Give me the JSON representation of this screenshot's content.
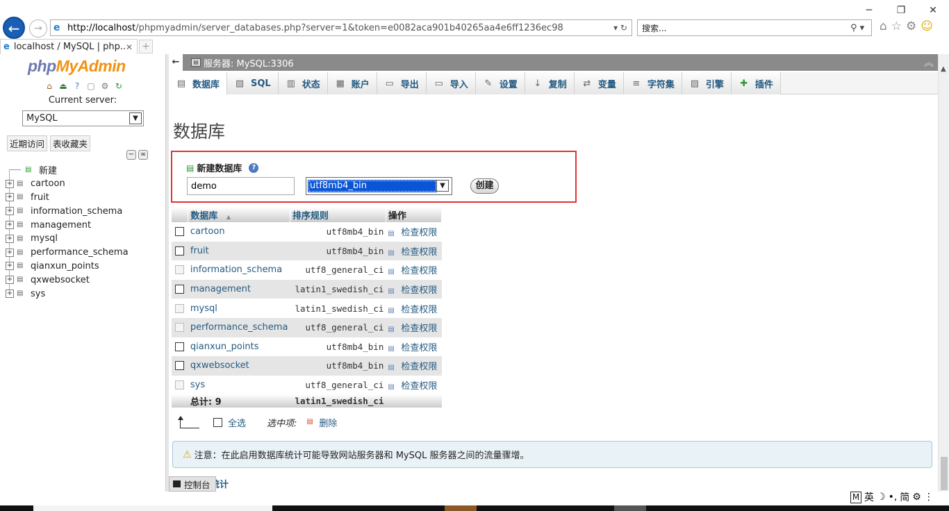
{
  "browser": {
    "url_host": "http://localhost",
    "url_rest": "/phpmyadmin/server_databases.php?server=1&token=e0082aca901b40265aa4e6ff1236ec98",
    "search_placeholder": "搜索...",
    "tab_title": "localhost / MySQL | php...",
    "tab_close": "✕",
    "new_tab": "＋"
  },
  "nav": {
    "logo_php": "php",
    "logo_myadmin": "MyAdmin",
    "current_server_label": "Current server:",
    "server_value": "MySQL",
    "recent_label": "近期访问",
    "favorites_label": "表收藏夹",
    "new_item": "新建",
    "databases": [
      "cartoon",
      "fruit",
      "information_schema",
      "management",
      "mysql",
      "performance_schema",
      "qianxun_points",
      "qxwebsocket",
      "sys"
    ]
  },
  "main": {
    "server_crumb": "服务器: MySQL:3306",
    "tabs": [
      {
        "label": "数据库",
        "icon": "database-icon"
      },
      {
        "label": "SQL",
        "icon": "sql-icon"
      },
      {
        "label": "状态",
        "icon": "status-icon"
      },
      {
        "label": "账户",
        "icon": "accounts-icon"
      },
      {
        "label": "导出",
        "icon": "export-icon"
      },
      {
        "label": "导入",
        "icon": "import-icon"
      },
      {
        "label": "设置",
        "icon": "settings-icon"
      },
      {
        "label": "复制",
        "icon": "replication-icon"
      },
      {
        "label": "变量",
        "icon": "variables-icon"
      },
      {
        "label": "字符集",
        "icon": "charset-icon"
      },
      {
        "label": "引擎",
        "icon": "engine-icon"
      },
      {
        "label": "插件",
        "icon": "plugin-icon"
      }
    ],
    "page_title": "数据库",
    "create": {
      "heading": "新建数据库",
      "name_value": "demo",
      "collation_selected": "utf8mb4_bin",
      "button_label": "创建"
    },
    "table": {
      "headers": {
        "database": "数据库",
        "sort_arrow": "▲",
        "collation": "排序规则",
        "action": "操作"
      },
      "rows": [
        {
          "name": "cartoon",
          "collation": "utf8mb4_bin",
          "action": "检查权限",
          "checkbox_enabled": true
        },
        {
          "name": "fruit",
          "collation": "utf8mb4_bin",
          "action": "检查权限",
          "checkbox_enabled": true
        },
        {
          "name": "information_schema",
          "collation": "utf8_general_ci",
          "action": "检查权限",
          "checkbox_enabled": false
        },
        {
          "name": "management",
          "collation": "latin1_swedish_ci",
          "action": "检查权限",
          "checkbox_enabled": true
        },
        {
          "name": "mysql",
          "collation": "latin1_swedish_ci",
          "action": "检查权限",
          "checkbox_enabled": false
        },
        {
          "name": "performance_schema",
          "collation": "utf8_general_ci",
          "action": "检查权限",
          "checkbox_enabled": false
        },
        {
          "name": "qianxun_points",
          "collation": "utf8mb4_bin",
          "action": "检查权限",
          "checkbox_enabled": true
        },
        {
          "name": "qxwebsocket",
          "collation": "utf8mb4_bin",
          "action": "检查权限",
          "checkbox_enabled": true
        },
        {
          "name": "sys",
          "collation": "utf8_general_ci",
          "action": "检查权限",
          "checkbox_enabled": false
        }
      ],
      "total_label": "总计: 9",
      "total_collation": "latin1_swedish_ci"
    },
    "bulk": {
      "select_all": "全选",
      "with_selected": "选中项:",
      "delete": "删除"
    },
    "notice": "注意：在此启用数据库统计可能导致网站服务器和 MySQL 服务器之间的流量骤增。",
    "stats_link": "统计",
    "console": "控制台"
  },
  "ime": {
    "mode": "M",
    "lang": "英",
    "moon": "☽",
    "punct": "•,",
    "script": "简"
  }
}
